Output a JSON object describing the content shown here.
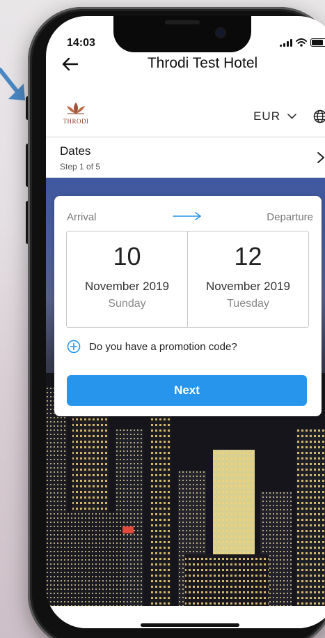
{
  "status_bar": {
    "time": "14:03",
    "battery_level": 0.8
  },
  "header": {
    "title": "Throdi Test Hotel",
    "back_icon": "arrow-left-icon"
  },
  "brand": {
    "logo_text": "THRODI",
    "currency": "EUR",
    "currency_icon": "chevron-down-icon",
    "language_icon": "globe-icon"
  },
  "step": {
    "title": "Dates",
    "subtitle": "Step 1 of 5",
    "icon": "chevron-right-icon"
  },
  "booking": {
    "arrival_label": "Arrival",
    "departure_label": "Departure",
    "arrival": {
      "day": "10",
      "month_year": "November 2019",
      "weekday": "Sunday"
    },
    "departure": {
      "day": "12",
      "month_year": "November 2019",
      "weekday": "Tuesday"
    },
    "promo_text": "Do you have a promotion code?",
    "promo_icon": "plus-circle-icon",
    "next_label": "Next"
  },
  "colors": {
    "accent": "#2695eb",
    "brand": "#8a3b24"
  }
}
